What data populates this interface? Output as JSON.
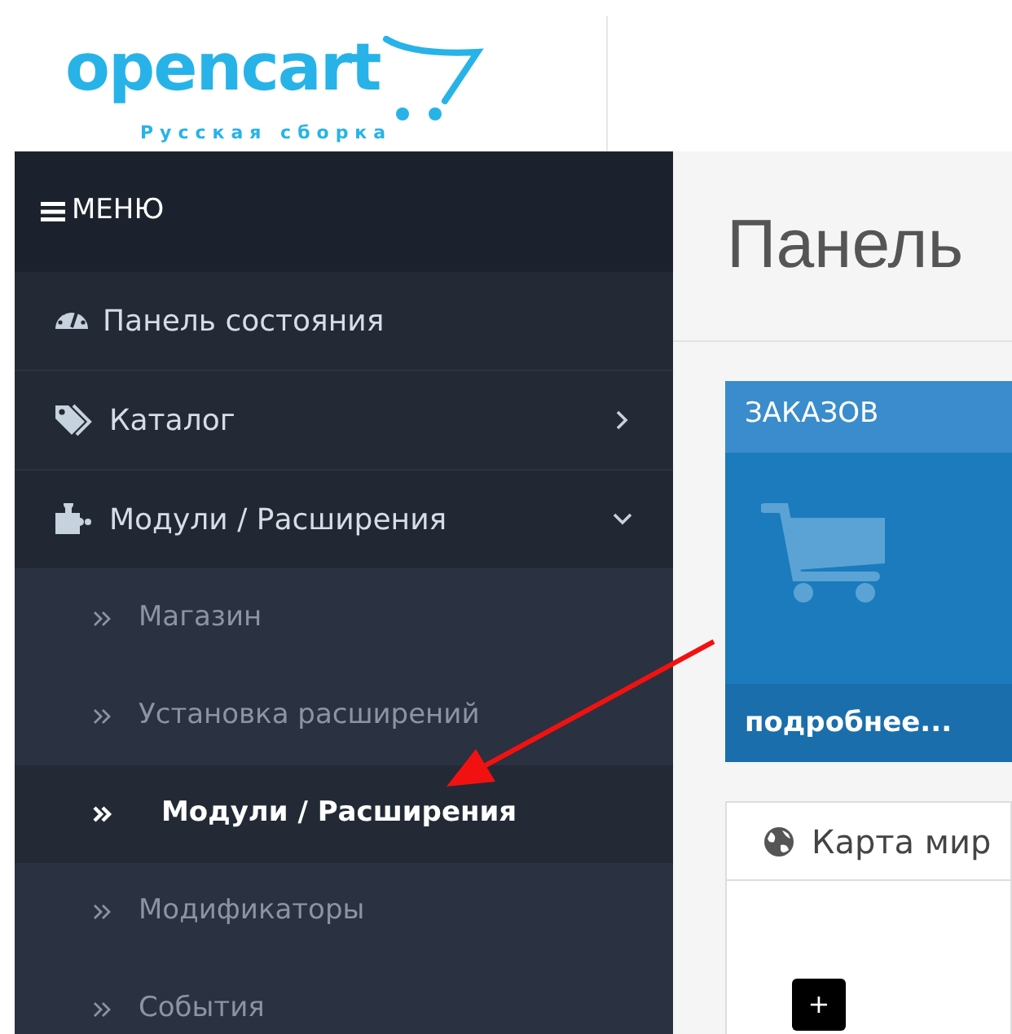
{
  "logo": {
    "name": "opencart",
    "subtitle": "Русская сборка"
  },
  "sidebar": {
    "heading": "МЕНЮ",
    "items": [
      {
        "label": "Панель состояния",
        "kind": "link"
      },
      {
        "label": "Каталог",
        "kind": "group",
        "expanded": false
      },
      {
        "label": "Модули / Расширения",
        "kind": "group",
        "expanded": true,
        "children": [
          {
            "label": "Магазин",
            "selected": false
          },
          {
            "label": "Установка расширений",
            "selected": false
          },
          {
            "label": "Модули / Расширения",
            "selected": true
          },
          {
            "label": "Модификаторы",
            "selected": false
          },
          {
            "label": "События",
            "selected": false
          }
        ]
      }
    ]
  },
  "main": {
    "page_title": "Панель",
    "tile": {
      "title": "ЗАКАЗОВ",
      "footer": "подробнее..."
    },
    "map_panel": {
      "title": "Карта мир",
      "zoom_button": "+"
    }
  }
}
